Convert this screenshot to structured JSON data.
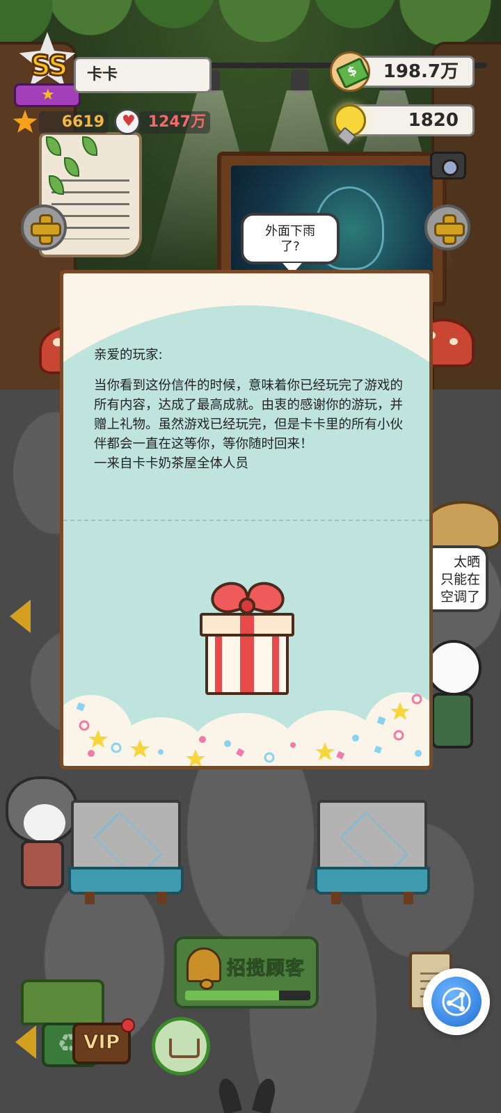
{
  "player": {
    "rank": "SS",
    "name": "卡卡",
    "stars": "6619",
    "fans": "1247万"
  },
  "currency": {
    "money": "198.7万",
    "ideas": "1820"
  },
  "bubbles": {
    "top": "外面下雨\n了?",
    "right": "太晒\n只能在\n空调了"
  },
  "letter": {
    "greeting": "亲爱的玩家:",
    "body": "当你看到这份信件的时候，意味着你已经玩完了游戏的所有内容，达成了最高成就。由衷的感谢你的游玩，并赠上礼物。虽然游戏已经玩完，但是卡卡里的所有小伙伴都会一直在这等你，等你随时回来！\n一来自卡卡奶茶屋全体人员"
  },
  "bottom": {
    "recruit_label": "招揽顾客",
    "recruit_progress": 0.75,
    "vip_label": "VIP"
  },
  "colors": {
    "accent_gold": "#d4a020",
    "stat_star": "#f5b642",
    "stat_fans": "#f06b6b",
    "letter_bg": "#bfe4de",
    "recruit_green": "#4c7e3e"
  },
  "icons": [
    "rank-star-icon",
    "star-icon",
    "fans-heart-icon",
    "money-icon",
    "bulb-icon",
    "camera-icon",
    "plus-icon",
    "bell-icon",
    "recycle-icon",
    "shop-cart-icon",
    "clipboard-icon",
    "assistant-icon",
    "left-arrow-icon",
    "gift-icon"
  ]
}
